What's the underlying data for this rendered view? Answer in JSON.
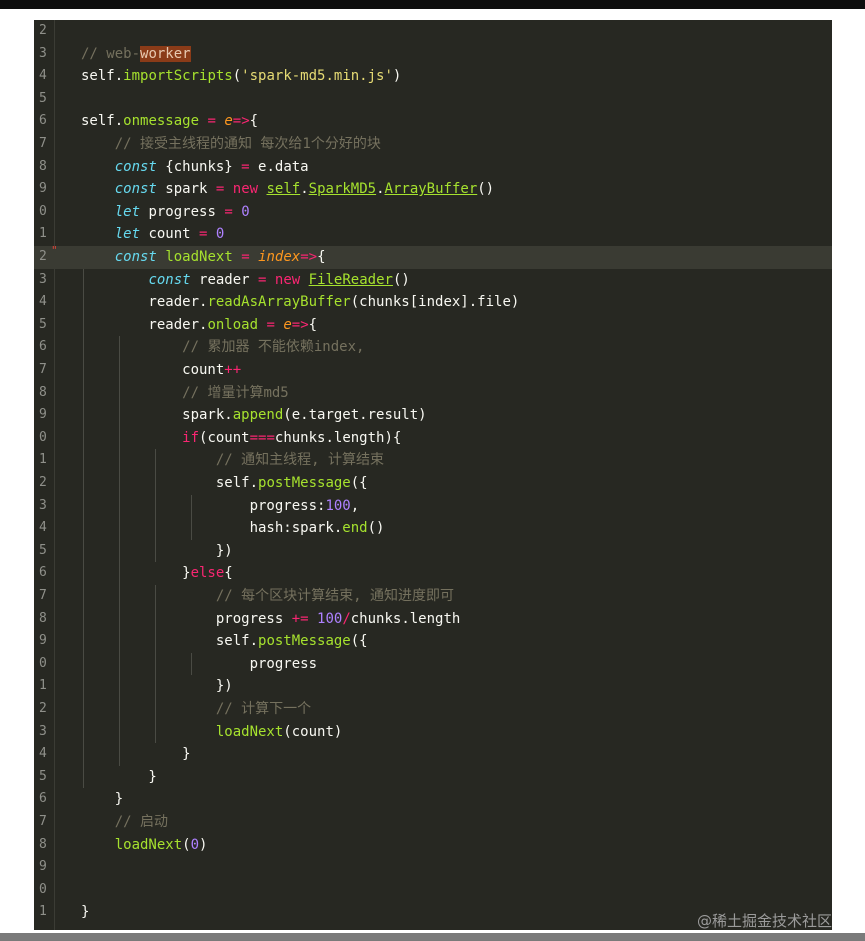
{
  "editor": {
    "lines": [
      {
        "n": "2",
        "s": []
      },
      {
        "n": "3",
        "s": [
          [
            "cm",
            "// web-"
          ],
          [
            "hl",
            "worker"
          ]
        ]
      },
      {
        "n": "4",
        "s": [
          [
            "t",
            "self."
          ],
          [
            "fn",
            "importScripts"
          ],
          [
            "t",
            "("
          ],
          [
            "str",
            "'spark-md5.min.js'"
          ],
          [
            "t",
            ")"
          ]
        ]
      },
      {
        "n": "5",
        "s": []
      },
      {
        "n": "6",
        "s": [
          [
            "t",
            "self."
          ],
          [
            "fn",
            "onmessage"
          ],
          [
            "t",
            " "
          ],
          [
            "op",
            "="
          ],
          [
            "t",
            " "
          ],
          [
            "prm",
            "e"
          ],
          [
            "op",
            "=>"
          ],
          [
            "t",
            "{"
          ]
        ]
      },
      {
        "n": "7",
        "s": [
          [
            "t",
            "    "
          ],
          [
            "cm",
            "// 接受主线程的通知 每次给1个分好的块"
          ]
        ]
      },
      {
        "n": "8",
        "s": [
          [
            "t",
            "    "
          ],
          [
            "kw",
            "const"
          ],
          [
            "t",
            " {chunks} "
          ],
          [
            "op",
            "="
          ],
          [
            "t",
            " e.data"
          ]
        ]
      },
      {
        "n": "9",
        "s": [
          [
            "t",
            "    "
          ],
          [
            "kw",
            "const"
          ],
          [
            "t",
            " spark "
          ],
          [
            "op",
            "="
          ],
          [
            "t",
            " "
          ],
          [
            "op",
            "new"
          ],
          [
            "t",
            " "
          ],
          [
            "fnu",
            "self"
          ],
          [
            "t",
            "."
          ],
          [
            "fnu",
            "SparkMD5"
          ],
          [
            "t",
            "."
          ],
          [
            "fnu",
            "ArrayBuffer"
          ],
          [
            "t",
            "()"
          ]
        ]
      },
      {
        "n": "0",
        "s": [
          [
            "t",
            "    "
          ],
          [
            "kw",
            "let"
          ],
          [
            "t",
            " progress "
          ],
          [
            "op",
            "="
          ],
          [
            "t",
            " "
          ],
          [
            "num",
            "0"
          ]
        ]
      },
      {
        "n": "1",
        "s": [
          [
            "t",
            "    "
          ],
          [
            "kw",
            "let"
          ],
          [
            "t",
            " count "
          ],
          [
            "op",
            "="
          ],
          [
            "t",
            " "
          ],
          [
            "num",
            "0"
          ]
        ]
      },
      {
        "n": "2",
        "s": [
          [
            "t",
            "    "
          ],
          [
            "kw",
            "const"
          ],
          [
            "t",
            " "
          ],
          [
            "fn",
            "loadNext"
          ],
          [
            "t",
            " "
          ],
          [
            "op",
            "="
          ],
          [
            "t",
            " "
          ],
          [
            "prm",
            "index"
          ],
          [
            "op",
            "=>"
          ],
          [
            "t",
            "{"
          ]
        ]
      },
      {
        "n": "3",
        "s": [
          [
            "t",
            "        "
          ],
          [
            "kw",
            "const"
          ],
          [
            "t",
            " reader "
          ],
          [
            "op",
            "="
          ],
          [
            "t",
            " "
          ],
          [
            "op",
            "new"
          ],
          [
            "t",
            " "
          ],
          [
            "fnu",
            "FileReader"
          ],
          [
            "t",
            "()"
          ]
        ]
      },
      {
        "n": "4",
        "s": [
          [
            "t",
            "        reader."
          ],
          [
            "fn",
            "readAsArrayBuffer"
          ],
          [
            "t",
            "(chunks[index].file)"
          ]
        ]
      },
      {
        "n": "5",
        "s": [
          [
            "t",
            "        reader."
          ],
          [
            "fn",
            "onload"
          ],
          [
            "t",
            " "
          ],
          [
            "op",
            "="
          ],
          [
            "t",
            " "
          ],
          [
            "prm",
            "e"
          ],
          [
            "op",
            "=>"
          ],
          [
            "t",
            "{"
          ]
        ]
      },
      {
        "n": "6",
        "s": [
          [
            "t",
            "            "
          ],
          [
            "cm",
            "// 累加器 不能依赖index,"
          ]
        ]
      },
      {
        "n": "7",
        "s": [
          [
            "t",
            "            count"
          ],
          [
            "op",
            "++"
          ]
        ]
      },
      {
        "n": "8",
        "s": [
          [
            "t",
            "            "
          ],
          [
            "cm",
            "// 增量计算md5"
          ]
        ]
      },
      {
        "n": "9",
        "s": [
          [
            "t",
            "            spark."
          ],
          [
            "fn",
            "append"
          ],
          [
            "t",
            "(e.target.result)"
          ]
        ]
      },
      {
        "n": "0",
        "s": [
          [
            "t",
            "            "
          ],
          [
            "op",
            "if"
          ],
          [
            "t",
            "(count"
          ],
          [
            "op",
            "==="
          ],
          [
            "t",
            "chunks.length){"
          ]
        ]
      },
      {
        "n": "1",
        "s": [
          [
            "t",
            "                "
          ],
          [
            "cm",
            "// 通知主线程, 计算结束"
          ]
        ]
      },
      {
        "n": "2",
        "s": [
          [
            "t",
            "                self."
          ],
          [
            "fn",
            "postMessage"
          ],
          [
            "t",
            "({"
          ]
        ]
      },
      {
        "n": "3",
        "s": [
          [
            "t",
            "                    progress:"
          ],
          [
            "num",
            "100"
          ],
          [
            "t",
            ","
          ]
        ]
      },
      {
        "n": "4",
        "s": [
          [
            "t",
            "                    hash:spark."
          ],
          [
            "fn",
            "end"
          ],
          [
            "t",
            "()"
          ]
        ]
      },
      {
        "n": "5",
        "s": [
          [
            "t",
            "                })"
          ]
        ]
      },
      {
        "n": "6",
        "s": [
          [
            "t",
            "            }"
          ],
          [
            "op",
            "else"
          ],
          [
            "t",
            "{"
          ]
        ]
      },
      {
        "n": "7",
        "s": [
          [
            "t",
            "                "
          ],
          [
            "cm",
            "// 每个区块计算结束, 通知进度即可"
          ]
        ]
      },
      {
        "n": "8",
        "s": [
          [
            "t",
            "                progress "
          ],
          [
            "op",
            "+="
          ],
          [
            "t",
            " "
          ],
          [
            "num",
            "100"
          ],
          [
            "op",
            "/"
          ],
          [
            "t",
            "chunks.length"
          ]
        ]
      },
      {
        "n": "9",
        "s": [
          [
            "t",
            "                self."
          ],
          [
            "fn",
            "postMessage"
          ],
          [
            "t",
            "({"
          ]
        ]
      },
      {
        "n": "0",
        "s": [
          [
            "t",
            "                    progress"
          ]
        ]
      },
      {
        "n": "1",
        "s": [
          [
            "t",
            "                })"
          ]
        ]
      },
      {
        "n": "2",
        "s": [
          [
            "t",
            "                "
          ],
          [
            "cm",
            "// 计算下一个"
          ]
        ]
      },
      {
        "n": "3",
        "s": [
          [
            "t",
            "                "
          ],
          [
            "fn",
            "loadNext"
          ],
          [
            "t",
            "(count)"
          ]
        ]
      },
      {
        "n": "4",
        "s": [
          [
            "t",
            "            }"
          ]
        ]
      },
      {
        "n": "5",
        "s": [
          [
            "t",
            "        }"
          ]
        ]
      },
      {
        "n": "6",
        "s": [
          [
            "t",
            "    }"
          ]
        ]
      },
      {
        "n": "7",
        "s": [
          [
            "t",
            "    "
          ],
          [
            "cm",
            "// 启动"
          ]
        ]
      },
      {
        "n": "8",
        "s": [
          [
            "t",
            "    "
          ],
          [
            "fn",
            "loadNext"
          ],
          [
            "t",
            "("
          ],
          [
            "num",
            "0"
          ],
          [
            "t",
            ")"
          ]
        ]
      },
      {
        "n": "9",
        "s": []
      },
      {
        "n": "0",
        "s": []
      },
      {
        "n": "1",
        "s": [
          [
            "t",
            "}"
          ]
        ]
      }
    ],
    "active_line": 10,
    "marker": "\""
  },
  "watermark": "@稀土掘金技术社区",
  "colors": {
    "background": "#272822",
    "comment": "#75715e",
    "keyword": "#66d9ef",
    "operator": "#f92672",
    "function": "#a6e22e",
    "string": "#e6db74",
    "number": "#ae81ff",
    "parameter": "#fd971f"
  }
}
